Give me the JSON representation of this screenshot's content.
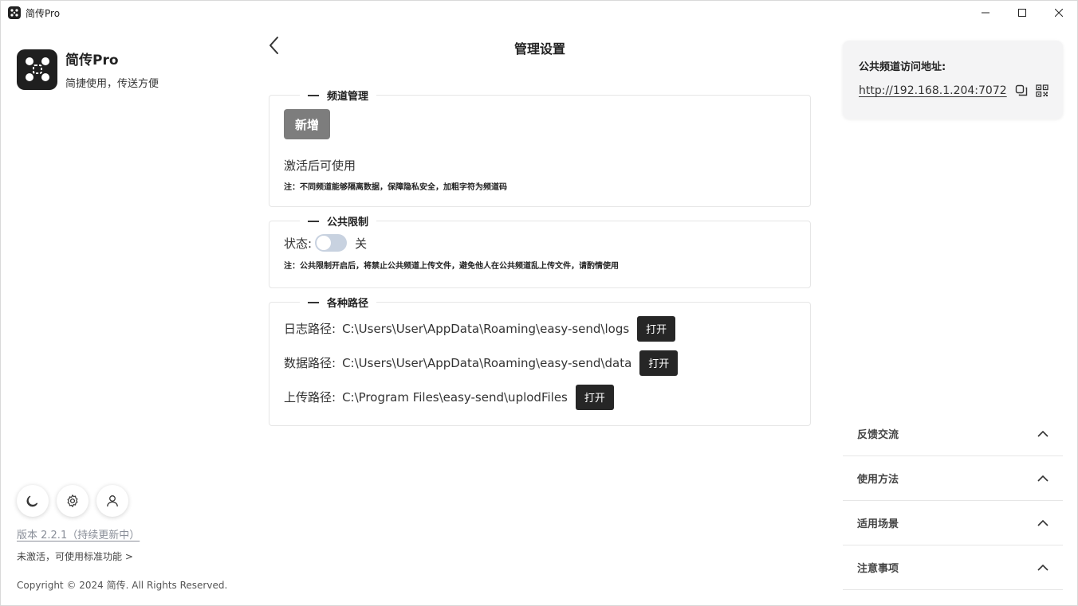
{
  "window": {
    "title": "简传Pro",
    "minimize_label": "—",
    "maximize_label": "☐",
    "close_label": "✕"
  },
  "sidebar": {
    "brand_name": "简传Pro",
    "slogan": "简捷使用，传送方便",
    "tools": [
      "moon-icon",
      "gear-icon",
      "user-icon"
    ],
    "version": "版本 2.2.1（持续更新中）",
    "activation_status": "未激活，可使用标准功能 >",
    "copyright": "Copyright © 2024 简传. All Rights Reserved."
  },
  "main": {
    "title": "管理设置",
    "channel": {
      "legend": "频道管理",
      "add_label": "新增",
      "activate_hint": "激活后可使用",
      "note": "注：不同频道能够隔离数据，保障隐私安全，加粗字符为频道码"
    },
    "public_limit": {
      "legend": "公共限制",
      "status_label": "状态:",
      "switch_state": "关",
      "switch_on": false,
      "note": "注：公共限制开启后，将禁止公共频道上传文件，避免他人在公共频道乱上传文件，请酌情使用"
    },
    "paths": {
      "legend": "各种路径",
      "open_label": "打开",
      "items": [
        {
          "label": "日志路径:",
          "value": "C:\\Users\\User\\AppData\\Roaming\\easy-send\\logs"
        },
        {
          "label": "数据路径:",
          "value": "C:\\Users\\User\\AppData\\Roaming\\easy-send\\data"
        },
        {
          "label": "上传路径:",
          "value": "C:\\Program Files\\easy-send\\uplodFiles"
        }
      ]
    }
  },
  "right": {
    "addr_title": "公共频道访问地址:",
    "addr_url": "http://192.168.1.204:7072",
    "accordion": [
      "反馈交流",
      "使用方法",
      "适用场景",
      "注意事项"
    ]
  },
  "colors": {
    "dark": "#262626",
    "muted_button": "#7d7d7d",
    "switch_off": "#c8d2e0",
    "panel_bg": "#f4f4f5"
  }
}
